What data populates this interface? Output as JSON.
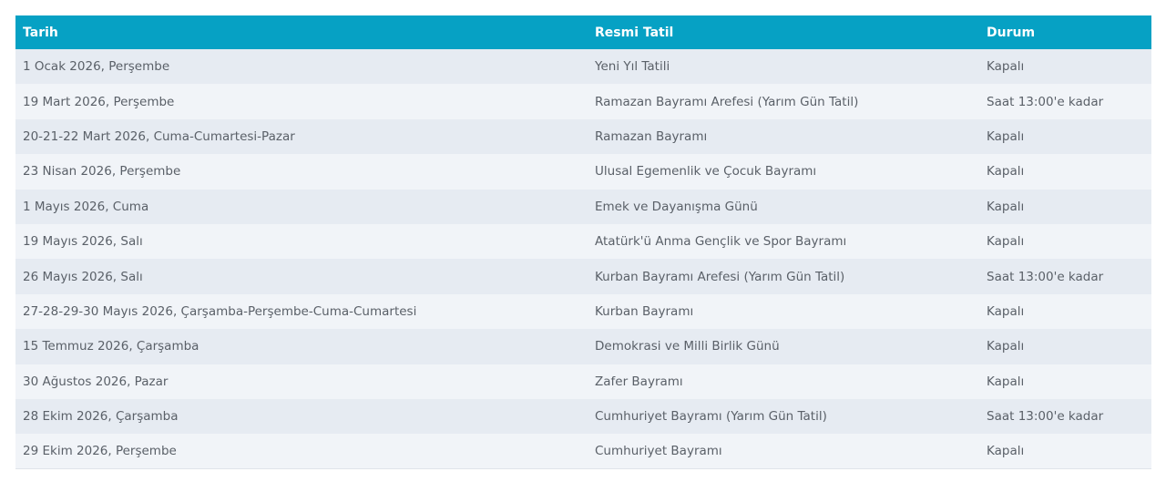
{
  "table": {
    "headers": [
      "Tarih",
      "Resmi Tatil",
      "Durum"
    ],
    "rows": [
      [
        "1 Ocak 2026, Perşembe",
        "Yeni Yıl Tatili",
        "Kapalı"
      ],
      [
        "19 Mart 2026, Perşembe",
        "Ramazan Bayramı Arefesi (Yarım Gün Tatil)",
        "Saat 13:00'e kadar"
      ],
      [
        "20-21-22 Mart 2026, Cuma-Cumartesi-Pazar",
        "Ramazan Bayramı",
        "Kapalı"
      ],
      [
        "23 Nisan 2026, Perşembe",
        "Ulusal Egemenlik ve Çocuk Bayramı",
        "Kapalı"
      ],
      [
        "1 Mayıs 2026, Cuma",
        "Emek ve Dayanışma Günü",
        "Kapalı"
      ],
      [
        "19 Mayıs 2026, Salı",
        "Atatürk'ü Anma Gençlik ve Spor Bayramı",
        "Kapalı"
      ],
      [
        "26 Mayıs 2026, Salı",
        "Kurban Bayramı Arefesi (Yarım Gün Tatil)",
        "Saat 13:00'e kadar"
      ],
      [
        "27-28-29-30 Mayıs 2026, Çarşamba-Perşembe-Cuma-Cumartesi",
        "Kurban Bayramı",
        "Kapalı"
      ],
      [
        "15 Temmuz 2026, Çarşamba",
        "Demokrasi ve Milli Birlik Günü",
        "Kapalı"
      ],
      [
        "30 Ağustos 2026, Pazar",
        "Zafer Bayramı",
        "Kapalı"
      ],
      [
        "28 Ekim 2026, Çarşamba",
        "Cumhuriyet Bayramı (Yarım Gün Tatil)",
        "Saat 13:00'e kadar"
      ],
      [
        "29 Ekim 2026, Perşembe",
        "Cumhuriyet Bayramı",
        "Kapalı"
      ]
    ]
  },
  "colors": {
    "header_bg": "#06a1c4",
    "header_text": "#ffffff",
    "row_odd": "#e6ebf2",
    "row_even": "#f1f4f8",
    "cell_text": "#5a6068"
  }
}
